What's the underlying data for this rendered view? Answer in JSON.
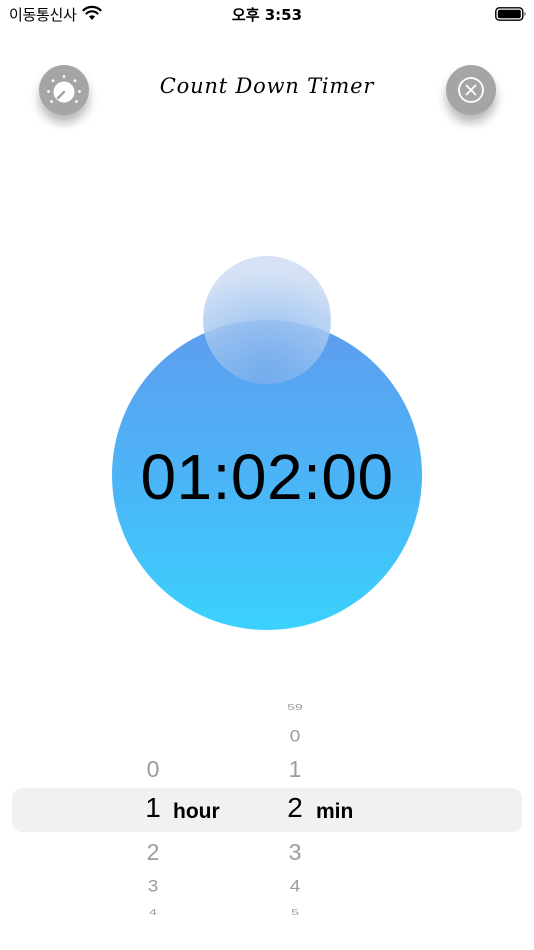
{
  "status_bar": {
    "carrier": "이동통신사",
    "time": "오후 3:53",
    "wifi_icon": "wifi-icon",
    "battery_icon": "battery-full-icon"
  },
  "header": {
    "title": "Count Down Timer",
    "settings_icon": "dial-icon",
    "close_icon": "close-circle-icon",
    "button_color": "#a5a5a8"
  },
  "timer": {
    "display": "01:02:00",
    "gradient_top": "#5f9cee",
    "gradient_bottom": "#3ad2fc"
  },
  "picker": {
    "hours": {
      "above": [
        "0"
      ],
      "selected": "1",
      "below": [
        "2",
        "3",
        "4"
      ],
      "unit": "hour"
    },
    "minutes": {
      "above": [
        "59",
        "0",
        "1"
      ],
      "selected": "2",
      "below": [
        "3",
        "4",
        "5"
      ],
      "unit": "min"
    }
  }
}
